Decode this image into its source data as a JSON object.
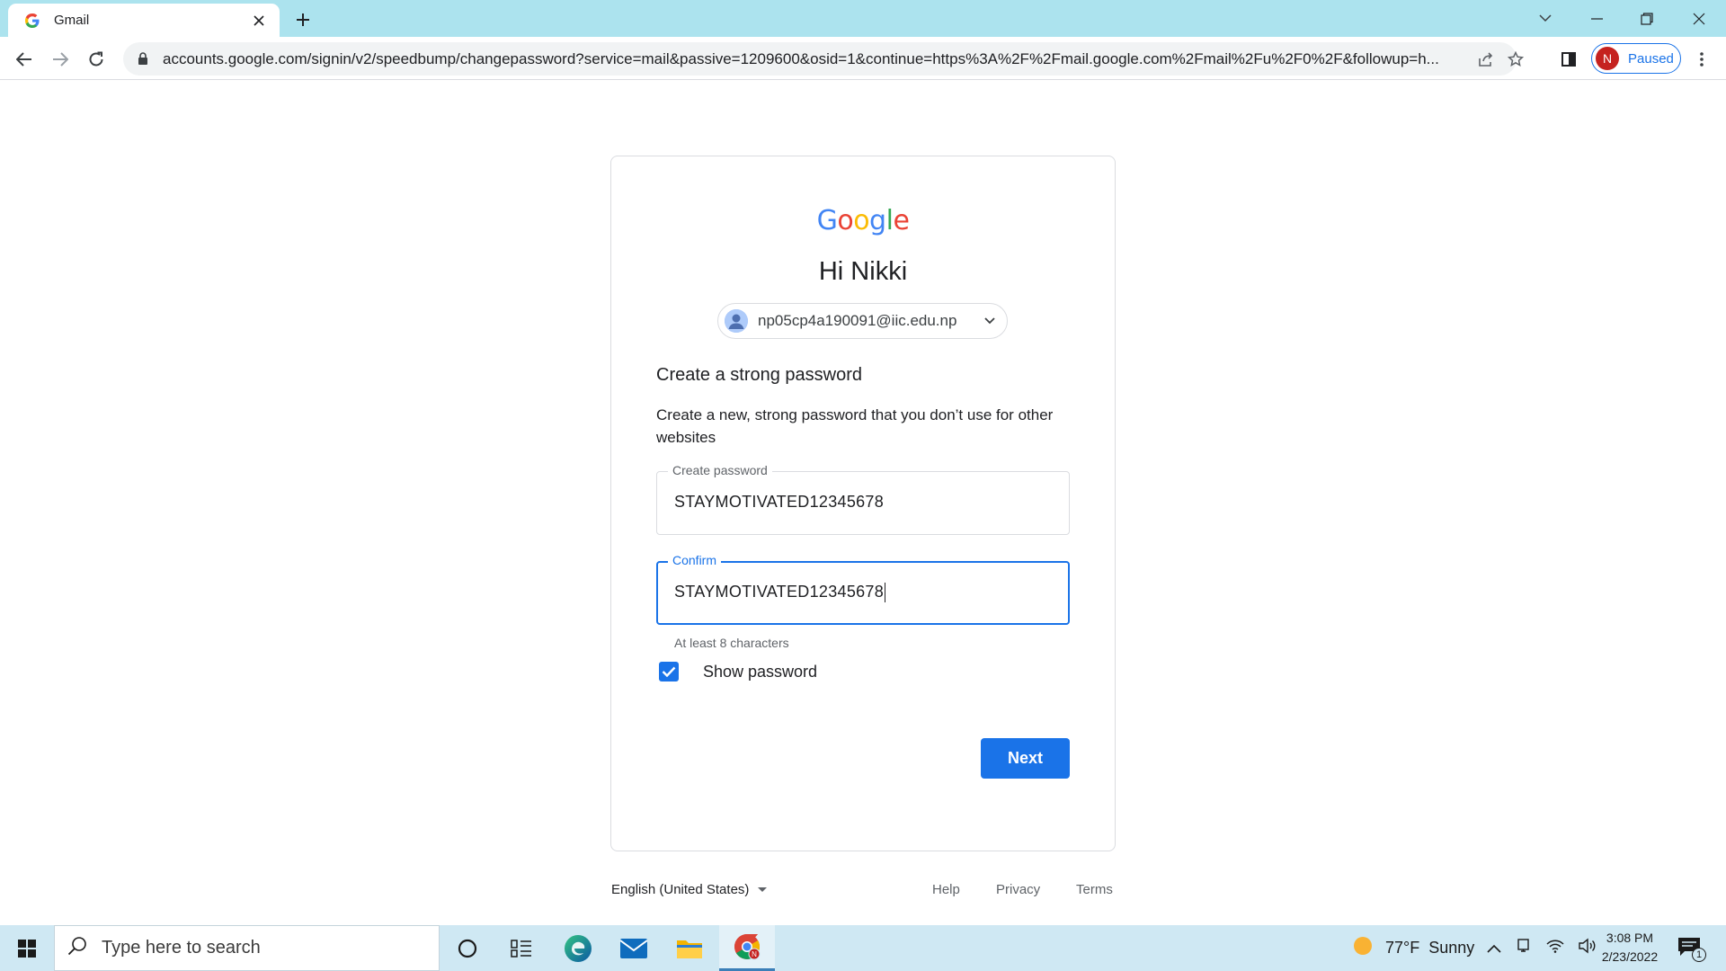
{
  "browser": {
    "tab_title": "Gmail",
    "url": "accounts.google.com/signin/v2/speedbump/changepassword?service=mail&passive=1209600&osid=1&continue=https%3A%2F%2Fmail.google.com%2Fmail%2Fu%2F0%2F&followup=h...",
    "profile_initial": "N",
    "profile_status": "Paused"
  },
  "card": {
    "logo_letters": [
      {
        "char": "G",
        "color": "#4285F4"
      },
      {
        "char": "o",
        "color": "#EA4335"
      },
      {
        "char": "o",
        "color": "#FBBC05"
      },
      {
        "char": "g",
        "color": "#4285F4"
      },
      {
        "char": "l",
        "color": "#34A853"
      },
      {
        "char": "e",
        "color": "#EA4335"
      }
    ],
    "greeting": "Hi Nikki",
    "account_email": "np05cp4a190091@iic.edu.np",
    "section_title": "Create a strong password",
    "section_desc": "Create a new, strong password that you don’t use for other websites",
    "create_password_label": "Create password",
    "create_password_value": "STAYMOTIVATED12345678",
    "confirm_label": "Confirm",
    "confirm_value": "STAYMOTIVATED12345678",
    "hint": "At least 8 characters",
    "show_password_label": "Show password",
    "show_password_checked": true,
    "next_label": "Next"
  },
  "footer": {
    "language": "English (United States)",
    "help": "Help",
    "privacy": "Privacy",
    "terms": "Terms"
  },
  "taskbar": {
    "search_placeholder": "Type here to search",
    "weather": "77°F  Sunny",
    "time": "3:08 PM",
    "date": "2/23/2022",
    "notification_count": "1"
  },
  "colors": {
    "accent": "#1a73e8",
    "tabbar": "#ace3ee",
    "taskbar": "#cfe8f3"
  }
}
